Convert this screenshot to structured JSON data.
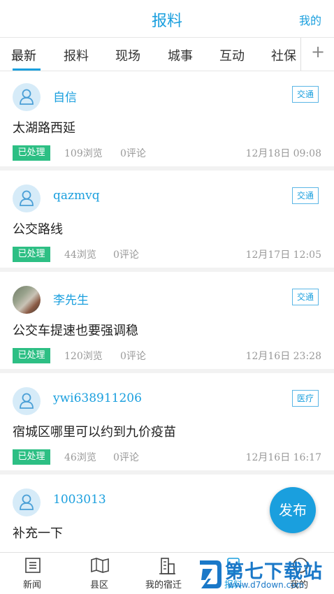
{
  "header": {
    "title": "报料",
    "mine": "我的"
  },
  "tabs": [
    {
      "label": "最新",
      "active": true
    },
    {
      "label": "报料"
    },
    {
      "label": "现场"
    },
    {
      "label": "城事"
    },
    {
      "label": "互动"
    },
    {
      "label": "社保"
    }
  ],
  "tab_add_icon": "plus-icon",
  "items": [
    {
      "user": "自信",
      "avatar": "default-user-icon",
      "tag": "交通",
      "title": "太湖路西延",
      "status": "已处理",
      "views": "109浏览",
      "comments": "0评论",
      "time": "12月18日  09:08"
    },
    {
      "user": "qazmvq",
      "avatar": "default-user-icon",
      "tag": "交通",
      "title": "公交路线",
      "status": "已处理",
      "views": "44浏览",
      "comments": "0评论",
      "time": "12月17日  12:05"
    },
    {
      "user": "李先生",
      "avatar": "photo-avatar",
      "tag": "交通",
      "title": "公交车提速也要强调稳",
      "status": "已处理",
      "views": "120浏览",
      "comments": "0评论",
      "time": "12月16日  23:28"
    },
    {
      "user": "ywi638911206",
      "avatar": "default-user-icon",
      "tag": "医疗",
      "title": "宿城区哪里可以约到九价疫苗",
      "status": "已处理",
      "views": "46浏览",
      "comments": "0评论",
      "time": "12月16日  16:17"
    },
    {
      "user": "1003013",
      "avatar": "default-user-icon",
      "tag": "",
      "title": "补充一下"
    }
  ],
  "fab": {
    "label": "发布"
  },
  "bottom_nav": [
    {
      "label": "新闻",
      "icon": "news-icon"
    },
    {
      "label": "县区",
      "icon": "map-icon"
    },
    {
      "label": "我的宿迁",
      "icon": "building-icon"
    },
    {
      "label": "报料",
      "icon": "report-icon"
    },
    {
      "label": "我的",
      "icon": "profile-icon"
    }
  ],
  "watermark": {
    "name": "第七下载站",
    "url": "www.d7down.com"
  },
  "colors": {
    "accent": "#1a9fde",
    "status_green": "#2dbf84",
    "divider": "#f2f2f2"
  }
}
